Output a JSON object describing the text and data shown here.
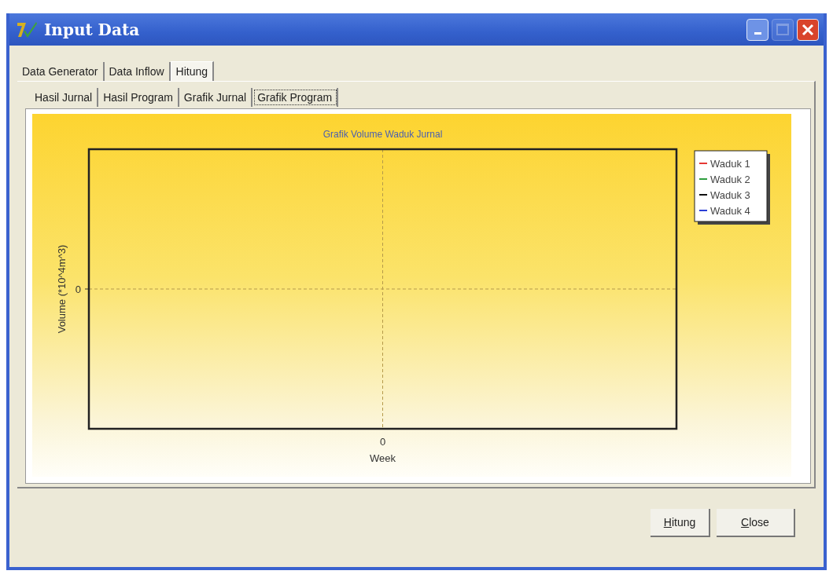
{
  "window": {
    "title": "Input Data",
    "minimize_disabled": false,
    "maximize_disabled": true
  },
  "tabs": [
    {
      "label": "Data Generator",
      "selected": false
    },
    {
      "label": "Data Inflow",
      "selected": false
    },
    {
      "label": "Hitung",
      "selected": true
    }
  ],
  "subtabs": [
    {
      "label": "Hasil Jurnal",
      "selected": false
    },
    {
      "label": "Hasil Program",
      "selected": false
    },
    {
      "label": "Grafik Jurnal",
      "selected": false
    },
    {
      "label": "Grafik Program",
      "selected": true
    }
  ],
  "chart": {
    "chart_data": {
      "type": "other",
      "title": "Grafik Volume Waduk Jurnal",
      "xlabel": "Week",
      "ylabel": "Volume (*10^4m^3)",
      "annotations": [
        {
          "text": "0"
        },
        {
          "text": "0"
        }
      ],
      "series": [
        {
          "name": "Waduk 1",
          "color": "#e53935"
        },
        {
          "name": "Waduk 2",
          "color": "#2e9e3e"
        },
        {
          "name": "Waduk 3",
          "color": "#111111"
        },
        {
          "name": "Waduk 4",
          "color": "#2b3fd6"
        }
      ]
    }
  },
  "buttons": [
    {
      "label": "Hitung",
      "first_letter_underlined": true
    },
    {
      "label": "Close",
      "first_letter_underlined": true
    }
  ]
}
